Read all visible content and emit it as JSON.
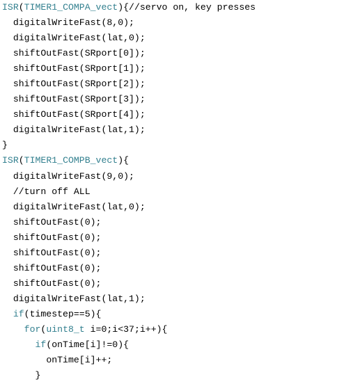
{
  "colors": {
    "keyword": "#33808f",
    "text": "#000000",
    "background": "#ffffff"
  },
  "code_lines": [
    {
      "indent": 0,
      "tokens": [
        {
          "t": "ISR",
          "k": 1
        },
        {
          "t": "("
        },
        {
          "t": "TIMER1_COMPA_vect",
          "k": 1
        },
        {
          "t": "){//servo on, key presses"
        }
      ]
    },
    {
      "indent": 2,
      "tokens": [
        {
          "t": "digitalWriteFast(8,0);"
        }
      ]
    },
    {
      "indent": 2,
      "tokens": [
        {
          "t": "digitalWriteFast(lat,0);"
        }
      ]
    },
    {
      "indent": 2,
      "tokens": [
        {
          "t": "shiftOutFast(SRport[0]);"
        }
      ]
    },
    {
      "indent": 2,
      "tokens": [
        {
          "t": "shiftOutFast(SRport[1]);"
        }
      ]
    },
    {
      "indent": 2,
      "tokens": [
        {
          "t": "shiftOutFast(SRport[2]);"
        }
      ]
    },
    {
      "indent": 2,
      "tokens": [
        {
          "t": "shiftOutFast(SRport[3]);"
        }
      ]
    },
    {
      "indent": 2,
      "tokens": [
        {
          "t": "shiftOutFast(SRport[4]);"
        }
      ]
    },
    {
      "indent": 2,
      "tokens": [
        {
          "t": "digitalWriteFast(lat,1);"
        }
      ]
    },
    {
      "indent": 0,
      "tokens": [
        {
          "t": "}"
        }
      ]
    },
    {
      "indent": 0,
      "tokens": [
        {
          "t": "ISR",
          "k": 1
        },
        {
          "t": "("
        },
        {
          "t": "TIMER1_COMPB_vect",
          "k": 1
        },
        {
          "t": "){"
        }
      ]
    },
    {
      "indent": 2,
      "tokens": [
        {
          "t": "digitalWriteFast(9,0);"
        }
      ]
    },
    {
      "indent": 2,
      "tokens": [
        {
          "t": "//turn off ALL"
        }
      ]
    },
    {
      "indent": 2,
      "tokens": [
        {
          "t": "digitalWriteFast(lat,0);"
        }
      ]
    },
    {
      "indent": 2,
      "tokens": [
        {
          "t": "shiftOutFast(0);"
        }
      ]
    },
    {
      "indent": 2,
      "tokens": [
        {
          "t": "shiftOutFast(0);"
        }
      ]
    },
    {
      "indent": 2,
      "tokens": [
        {
          "t": "shiftOutFast(0);"
        }
      ]
    },
    {
      "indent": 2,
      "tokens": [
        {
          "t": "shiftOutFast(0);"
        }
      ]
    },
    {
      "indent": 2,
      "tokens": [
        {
          "t": "shiftOutFast(0);"
        }
      ]
    },
    {
      "indent": 2,
      "tokens": [
        {
          "t": "digitalWriteFast(lat,1);"
        }
      ]
    },
    {
      "indent": 2,
      "tokens": [
        {
          "t": "if",
          "k": 1
        },
        {
          "t": "(timestep==5){"
        }
      ]
    },
    {
      "indent": 4,
      "tokens": [
        {
          "t": "for",
          "k": 1
        },
        {
          "t": "("
        },
        {
          "t": "uint8_t",
          "k": 1
        },
        {
          "t": " i=0;i<37;i++){"
        }
      ]
    },
    {
      "indent": 6,
      "tokens": [
        {
          "t": "if",
          "k": 1
        },
        {
          "t": "(onTime[i]!=0){"
        }
      ]
    },
    {
      "indent": 8,
      "tokens": [
        {
          "t": "onTime[i]++;"
        }
      ]
    },
    {
      "indent": 6,
      "tokens": [
        {
          "t": "}"
        }
      ]
    }
  ]
}
